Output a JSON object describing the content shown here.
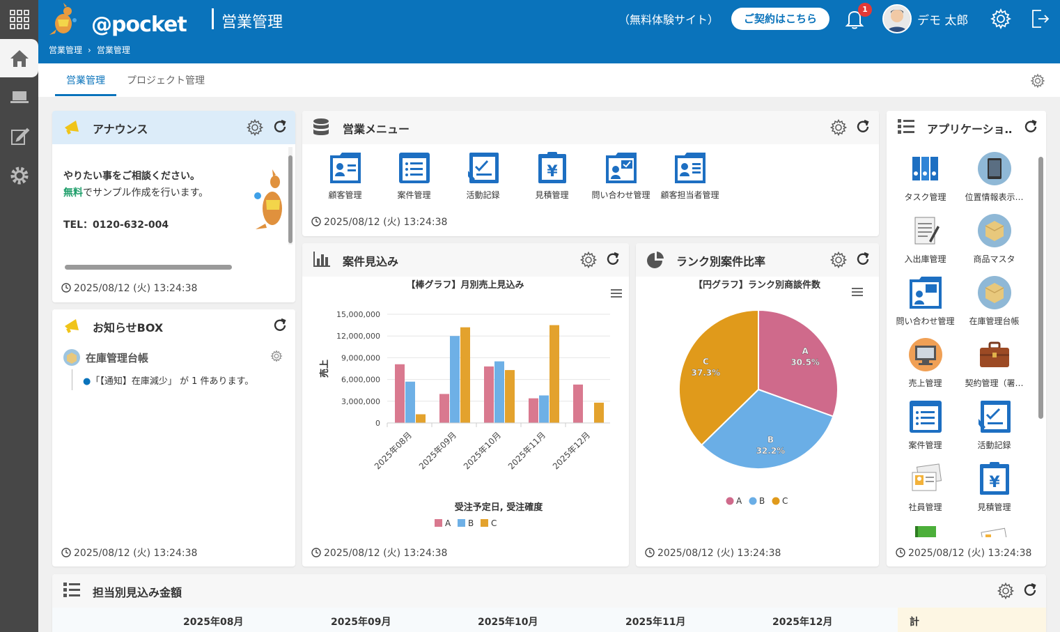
{
  "header": {
    "brand": "@pocket",
    "breadcrumb": [
      "営業管理",
      "›",
      "営業管理"
    ],
    "app_title": "営業管理",
    "trial_label": "（無料体験サイト）",
    "contract_button": "ご契約はこちら",
    "notification_count": "1",
    "user_name": "デモ 太郎",
    "brand_color": "#0a73bb"
  },
  "tabs": [
    {
      "label": "営業管理",
      "active": true
    },
    {
      "label": "プロジェクト管理",
      "active": false
    }
  ],
  "announce": {
    "title": "アナウンス",
    "line1": "やりたい事をご相談ください。",
    "line2_highlight": "無料",
    "line2_rest": "でサンプル作成を行います。",
    "tel": "TEL：0120-632-004",
    "timestamp": "2025/08/12 (火) 13:24:38"
  },
  "notice": {
    "title": "お知らせBOX",
    "item_title": "在庫管理台帳",
    "item_text": "「【通知】在庫減少」 が 1 件あります。",
    "timestamp": "2025/08/12 (火) 13:24:38"
  },
  "sales_menu": {
    "title": "営業メニュー",
    "items": [
      "顧客管理",
      "案件管理",
      "活動記録",
      "見積管理",
      "問い合わせ管理",
      "顧客担当者管理"
    ],
    "timestamp": "2025/08/12 (火) 13:24:38"
  },
  "prospect": {
    "title": "案件見込み",
    "timestamp": "2025/08/12 (火) 13:24:38"
  },
  "rank": {
    "title": "ランク別案件比率",
    "timestamp": "2025/08/12 (火) 13:24:38"
  },
  "apps": {
    "title": "アプリケーショ…",
    "items": [
      "タスク管理",
      "位置情報表示…",
      "入出庫管理",
      "商品マスタ",
      "問い合わせ管理",
      "在庫管理台帳",
      "売上管理",
      "契約管理（署…",
      "案件管理",
      "活動記録",
      "社員管理",
      "見積管理"
    ],
    "timestamp": "2025/08/12 (火) 13:24:38"
  },
  "bottom": {
    "title": "担当別見込み金額",
    "columns": [
      "2025年08月",
      "2025年09月",
      "2025年10月",
      "2025年11月",
      "2025年12月",
      "計"
    ]
  },
  "chart_data": [
    {
      "type": "bar",
      "title": "【棒グラフ】月別売上見込み",
      "xlabel": "受注予定日, 受注確度",
      "ylabel": "売上",
      "categories": [
        "2025年08月",
        "2025年09月",
        "2025年10月",
        "2025年11月",
        "2025年12月"
      ],
      "y_ticks": [
        "0",
        "3,000,000",
        "6,000,000",
        "9,000,000",
        "12,000,000",
        "15,000,000"
      ],
      "ylim": [
        0,
        15000000
      ],
      "series": [
        {
          "name": "A",
          "color": "#d9798f",
          "values": [
            8100000,
            4000000,
            7800000,
            3400000,
            5300000
          ]
        },
        {
          "name": "B",
          "color": "#6eb0e6",
          "values": [
            5700000,
            12000000,
            8500000,
            3800000,
            0
          ]
        },
        {
          "name": "C",
          "color": "#e3a22d",
          "values": [
            1200000,
            13200000,
            7300000,
            13500000,
            2800000
          ]
        }
      ],
      "legend": "bottom"
    },
    {
      "type": "pie",
      "title": "【円グラフ】ランク別商談件数",
      "slices": [
        {
          "name": "A",
          "label": "30.5%",
          "value": 30.5,
          "color": "#cf6a8b"
        },
        {
          "name": "B",
          "label": "32.2%",
          "value": 32.2,
          "color": "#6aaee6"
        },
        {
          "name": "C",
          "label": "37.3%",
          "value": 37.3,
          "color": "#e09a1b"
        }
      ],
      "legend": "bottom"
    }
  ]
}
